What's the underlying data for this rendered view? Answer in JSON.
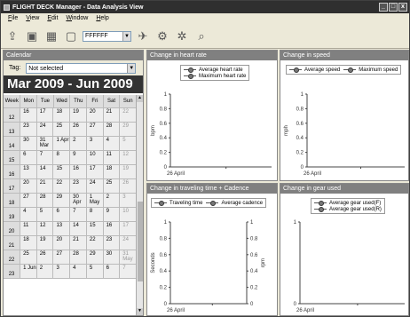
{
  "window": {
    "title": "FLIGHT DECK Manager - Data Analysis View",
    "buttons": [
      "_",
      "□",
      "x"
    ]
  },
  "menu": [
    "File",
    "View",
    "Edit",
    "Window",
    "Help"
  ],
  "toolbar": {
    "color_value": "FFFFFF"
  },
  "calendar": {
    "header": "Calendar",
    "tag_label": "Tag:",
    "tag_value": "Not selected",
    "range": "Mar 2009 - Jun 2009",
    "columns": [
      "Week",
      "Mon",
      "Tue",
      "Wed",
      "Thu",
      "Fri",
      "Sat",
      "Sun"
    ],
    "rows": [
      [
        "12",
        "16",
        "17",
        "18",
        "19",
        "20",
        "21",
        "22"
      ],
      [
        "13",
        "23",
        "24",
        "25",
        "26",
        "27",
        "28",
        "29"
      ],
      [
        "14",
        "30",
        "31 Mar",
        "1 Apr",
        "2",
        "3",
        "4",
        "5"
      ],
      [
        "15",
        "6",
        "7",
        "8",
        "9",
        "10",
        "11",
        "12"
      ],
      [
        "16",
        "13",
        "14",
        "15",
        "16",
        "17",
        "18",
        "19"
      ],
      [
        "17",
        "20",
        "21",
        "22",
        "23",
        "24",
        "25",
        "26"
      ],
      [
        "18",
        "27",
        "28",
        "29",
        "30 Apr",
        "1 May",
        "2",
        "3"
      ],
      [
        "19",
        "4",
        "5",
        "6",
        "7",
        "8",
        "9",
        "10"
      ],
      [
        "20",
        "11",
        "12",
        "13",
        "14",
        "15",
        "16",
        "17"
      ],
      [
        "21",
        "18",
        "19",
        "20",
        "21",
        "22",
        "23",
        "24"
      ],
      [
        "22",
        "25",
        "26",
        "27",
        "28",
        "29",
        "30",
        "31 May"
      ],
      [
        "23",
        "1 Jun",
        "2",
        "3",
        "4",
        "5",
        "6",
        "7"
      ]
    ]
  },
  "charts": [
    {
      "id": "heart",
      "header": "Change in heart rate",
      "legend": [
        "Average heart rate",
        "Maximum heart rate"
      ],
      "ylabel_left": "bpm",
      "ylabel_right": "",
      "xtick": "26 April"
    },
    {
      "id": "speed",
      "header": "Change in speed",
      "legend": [
        "Average speed",
        "Maximum speed"
      ],
      "ylabel_left": "mph",
      "ylabel_right": "",
      "xtick": "26 April"
    },
    {
      "id": "time",
      "header": "Change in traveling time + Cadence",
      "legend": [
        "Traveling time",
        "Average cadence"
      ],
      "ylabel_left": "Seconds",
      "ylabel_right": "rpm",
      "xtick": "26 April"
    },
    {
      "id": "gear",
      "header": "Change in gear used",
      "legend": [
        "Average gear used(F)",
        "Average gear used(R)"
      ],
      "ylabel_left": "",
      "ylabel_right": "",
      "xtick": "26 April"
    }
  ],
  "chart_data": [
    {
      "type": "line",
      "title": "Change in heart rate",
      "ylabel": "bpm",
      "yticks": [
        "0",
        "0.2",
        "0.4",
        "0.6",
        "0.8",
        "1"
      ],
      "ylim": [
        0,
        1
      ],
      "x": [
        "26 April"
      ],
      "series": [
        {
          "name": "Average heart rate",
          "values": []
        },
        {
          "name": "Maximum heart rate",
          "values": []
        }
      ]
    },
    {
      "type": "line",
      "title": "Change in speed",
      "ylabel": "mph",
      "yticks": [
        "0",
        "0.2",
        "0.4",
        "0.6",
        "0.8",
        "1"
      ],
      "ylim": [
        0,
        1
      ],
      "x": [
        "26 April"
      ],
      "series": [
        {
          "name": "Average speed",
          "values": []
        },
        {
          "name": "Maximum speed",
          "values": []
        }
      ]
    },
    {
      "type": "line",
      "title": "Change in traveling time + Cadence",
      "ylabel": "Seconds",
      "y2label": "rpm",
      "yticks": [
        "0",
        "0.2",
        "0.4",
        "0.6",
        "0.8",
        "1"
      ],
      "ylim": [
        0,
        1
      ],
      "x": [
        "26 April"
      ],
      "series": [
        {
          "name": "Traveling time",
          "values": []
        },
        {
          "name": "Average cadence",
          "values": []
        }
      ]
    },
    {
      "type": "line",
      "title": "Change in gear used",
      "yticks": [
        "0",
        "1"
      ],
      "ylim": [
        0,
        1
      ],
      "x": [
        "26 April"
      ],
      "series": [
        {
          "name": "Average gear used(F)",
          "values": []
        },
        {
          "name": "Average gear used(R)",
          "values": []
        }
      ]
    }
  ]
}
